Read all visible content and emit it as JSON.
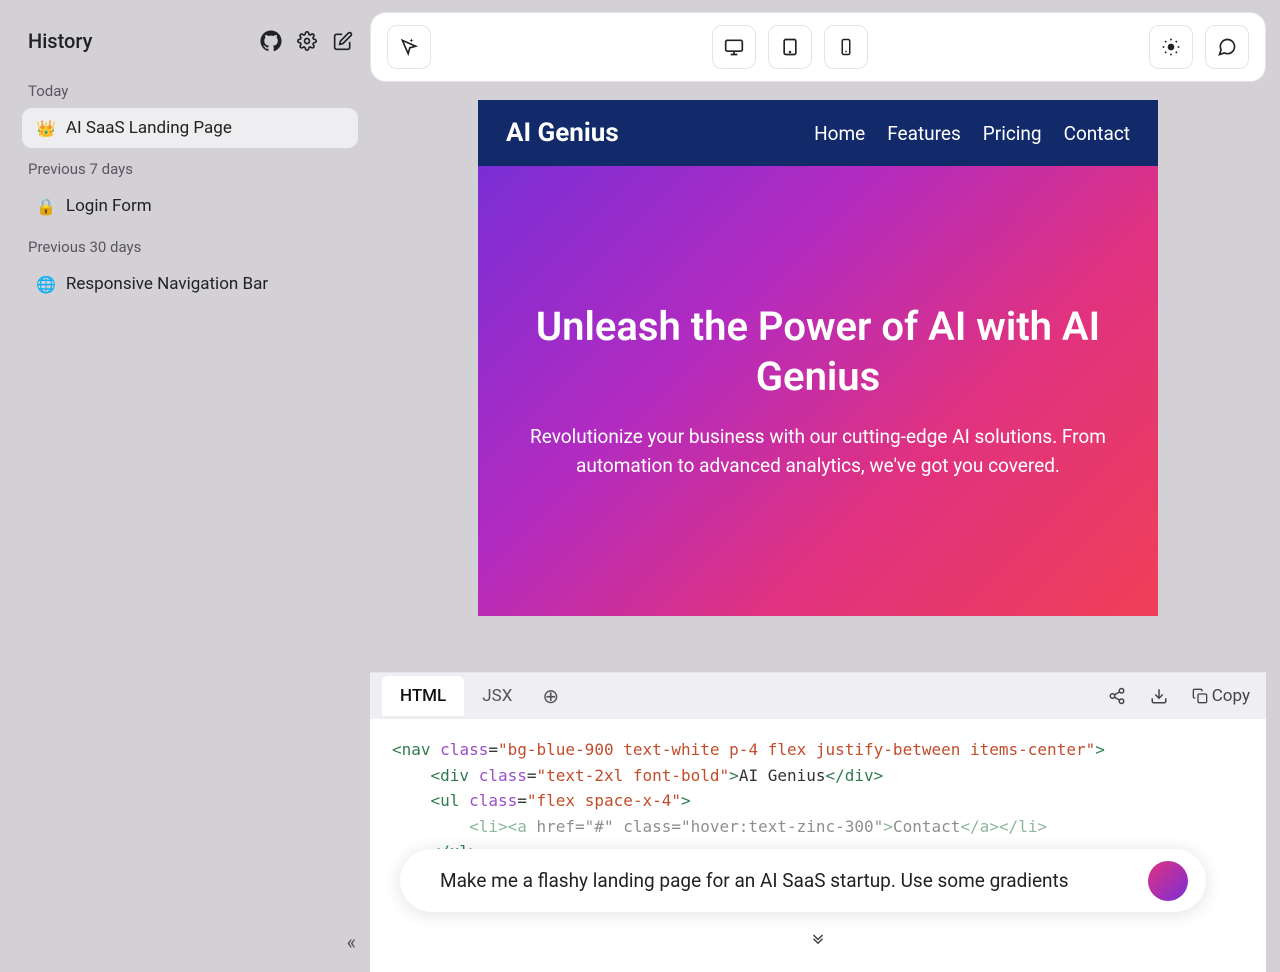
{
  "sidebar": {
    "title": "History",
    "sections": [
      {
        "label": "Today",
        "items": [
          {
            "emoji": "👑",
            "label": "AI SaaS Landing Page",
            "active": true
          }
        ]
      },
      {
        "label": "Previous 7 days",
        "items": [
          {
            "emoji": "🔒",
            "label": "Login Form",
            "active": false
          }
        ]
      },
      {
        "label": "Previous 30 days",
        "items": [
          {
            "emoji": "🌐",
            "label": "Responsive Navigation Bar",
            "active": false
          }
        ]
      }
    ]
  },
  "preview": {
    "brand": "AI Genius",
    "nav_links": [
      "Home",
      "Features",
      "Pricing",
      "Contact"
    ],
    "hero_title": "Unleash the Power of AI with AI Genius",
    "hero_sub": "Revolutionize your business with our cutting-edge AI solutions. From automation to advanced analytics, we've got you covered."
  },
  "code_panel": {
    "tabs": [
      "HTML",
      "JSX"
    ],
    "active_tab": "HTML",
    "copy_label": "Copy",
    "code_lines": [
      {
        "tag": "nav",
        "attrs": "class=\"bg-blue-900 text-white p-4 flex justify-between items-center\"",
        "open": true
      },
      {
        "indent": 1,
        "tag": "div",
        "attrs": "class=\"text-2xl font-bold\"",
        "text": "AI Genius",
        "close": true
      },
      {
        "indent": 1,
        "tag": "ul",
        "attrs": "class=\"flex space-x-4\"",
        "open": true
      },
      {
        "indent": 2,
        "raw": "<li><a href=\"#\" class=\"hover:text-zinc-300\">Contact</a></li>"
      },
      {
        "indent": 1,
        "closing": "ul"
      }
    ]
  },
  "prompt": {
    "text": "Make me a flashy landing page for an AI SaaS startup.  Use some gradients"
  },
  "colors": {
    "sidebar_bg": "#d3d0d6",
    "nav_bg": "#122a6a",
    "hero_gradient": [
      "#7a2ed6",
      "#b22bc0",
      "#e03280",
      "#ef3f57"
    ]
  }
}
